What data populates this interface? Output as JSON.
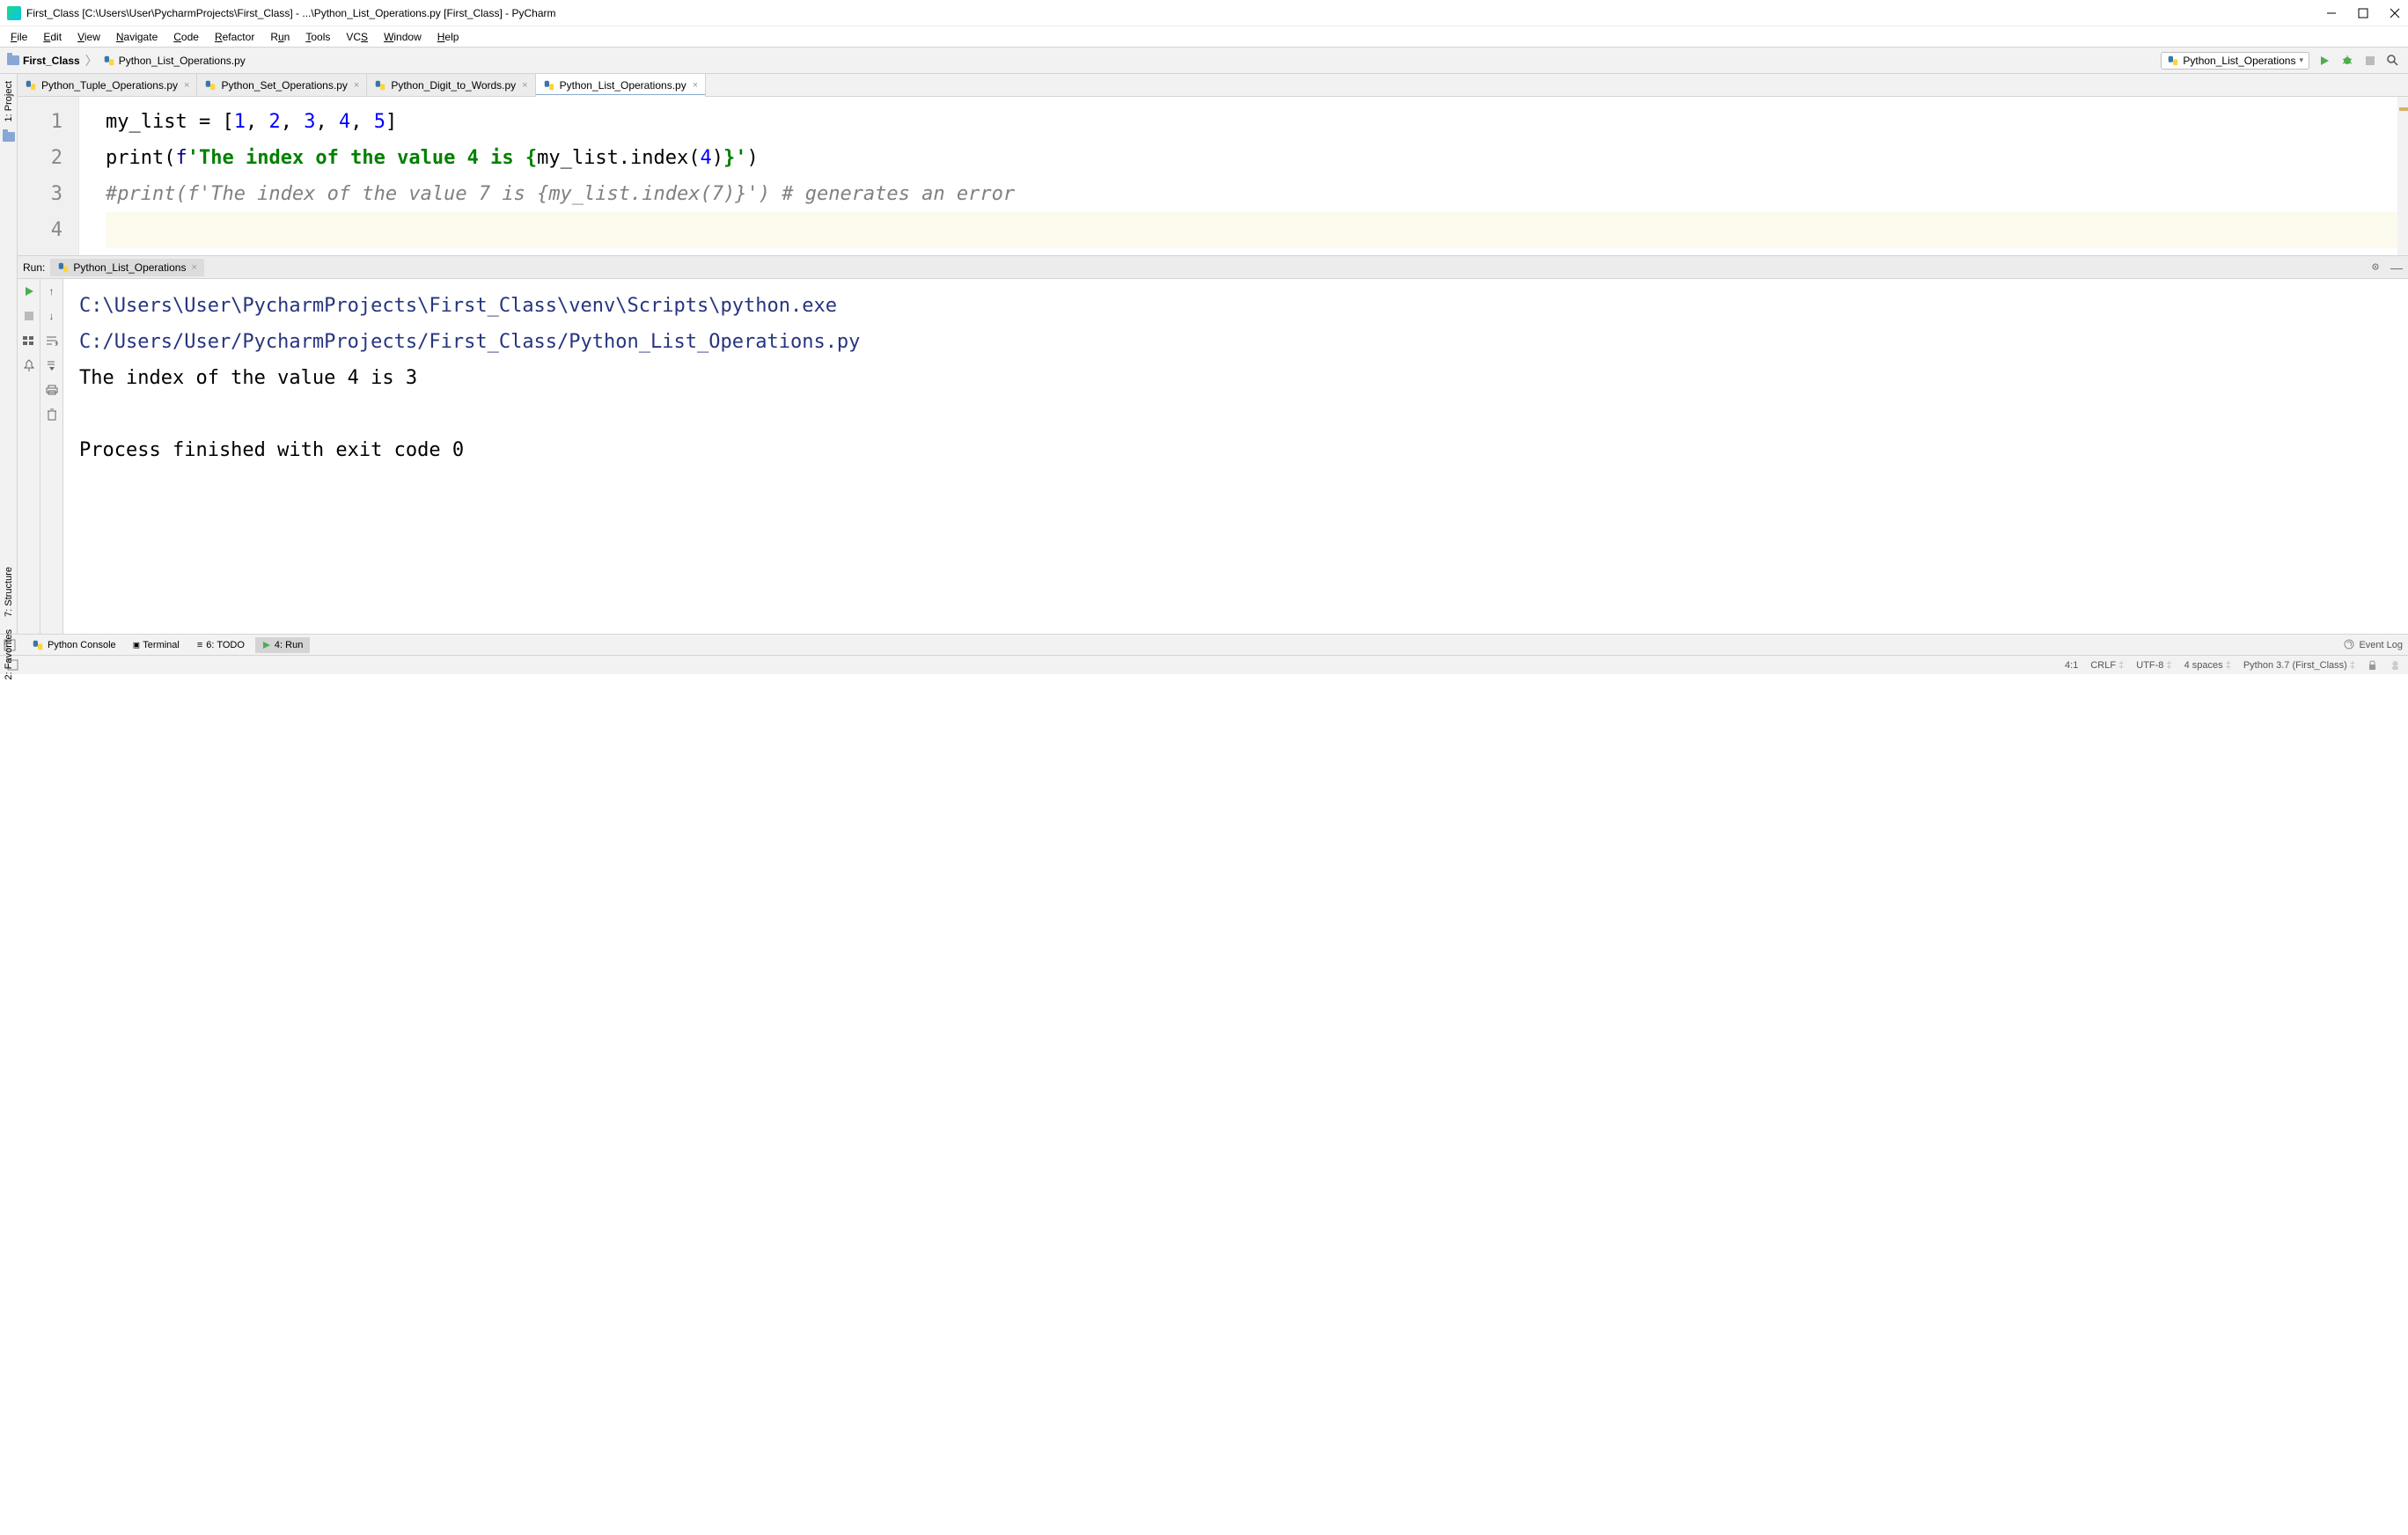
{
  "titlebar": {
    "title": "First_Class [C:\\Users\\User\\PycharmProjects\\First_Class] - ...\\Python_List_Operations.py [First_Class] - PyCharm"
  },
  "menubar": [
    {
      "label": "File",
      "u": "F"
    },
    {
      "label": "Edit",
      "u": "E"
    },
    {
      "label": "View",
      "u": "V"
    },
    {
      "label": "Navigate",
      "u": "N"
    },
    {
      "label": "Code",
      "u": "C"
    },
    {
      "label": "Refactor",
      "u": "R"
    },
    {
      "label": "Run",
      "u": "u"
    },
    {
      "label": "Tools",
      "u": "T"
    },
    {
      "label": "VCS",
      "u": "S"
    },
    {
      "label": "Window",
      "u": "W"
    },
    {
      "label": "Help",
      "u": "H"
    }
  ],
  "breadcrumb": {
    "project": "First_Class",
    "file": "Python_List_Operations.py"
  },
  "run_config": {
    "label": "Python_List_Operations"
  },
  "tabs": [
    {
      "label": "Python_Tuple_Operations.py",
      "active": false
    },
    {
      "label": "Python_Set_Operations.py",
      "active": false
    },
    {
      "label": "Python_Digit_to_Words.py",
      "active": false
    },
    {
      "label": "Python_List_Operations.py",
      "active": true
    }
  ],
  "editor": {
    "line_numbers": [
      "1",
      "2",
      "3",
      "4"
    ],
    "lines": {
      "l1_var": "my_list",
      "l1_assign": " = [",
      "l1_n1": "1",
      "l1_c1": ", ",
      "l1_n2": "2",
      "l1_c2": ", ",
      "l1_n3": "3",
      "l1_c3": ", ",
      "l1_n4": "4",
      "l1_c4": ", ",
      "l1_n5": "5",
      "l1_close": "]",
      "l2_print": "print(",
      "l2_f": "f",
      "l2_str1": "'The index of the value 4 is {",
      "l2_expr": "my_list.index(",
      "l2_arg": "4",
      "l2_expr2": ")",
      "l2_str2": "}'",
      "l2_close": ")",
      "l3_comment": "#print(f'The index of the value 7 is {my_list.index(7)}') # generates an error"
    }
  },
  "left_tool": {
    "project": "1: Project"
  },
  "left_side": {
    "structure": "7: Structure",
    "favorites": "2: Favorites"
  },
  "run": {
    "label": "Run:",
    "tab": "Python_List_Operations",
    "path1": "C:\\Users\\User\\PycharmProjects\\First_Class\\venv\\Scripts\\python.exe",
    "path2": " C:/Users/User/PycharmProjects/First_Class/Python_List_Operations.py",
    "out1": "The index of the value 4 is 3",
    "out2": "Process finished with exit code 0"
  },
  "bottom_tabs": {
    "python_console": "Python Console",
    "terminal": "Terminal",
    "todo": "6: TODO",
    "run": "4: Run",
    "event_log": "Event Log"
  },
  "status": {
    "pos": "4:1",
    "line_sep": "CRLF",
    "encoding": "UTF-8",
    "indent": "4 spaces",
    "interpreter": "Python 3.7 (First_Class)"
  }
}
